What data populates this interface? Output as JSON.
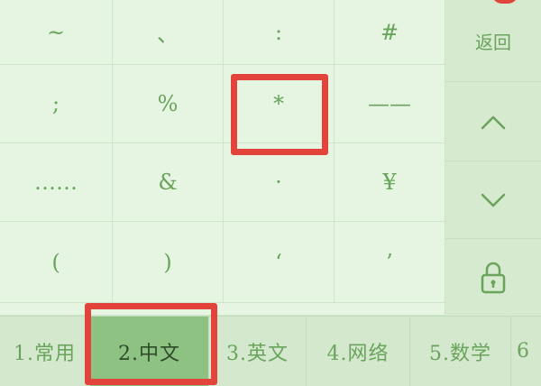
{
  "keypad": {
    "rows": [
      [
        "~",
        "、",
        ":",
        "#"
      ],
      [
        ";",
        "%",
        "*",
        "——"
      ],
      [
        "……",
        "&",
        "·",
        "¥"
      ],
      [
        "(",
        ")",
        "‘",
        "’"
      ]
    ]
  },
  "sidebar": {
    "back_label": "返回",
    "up_icon": "chevron-up-icon",
    "down_icon": "chevron-down-icon",
    "lock_icon": "lock-icon"
  },
  "tabs": [
    {
      "label": "1.常用"
    },
    {
      "label": "2.中文",
      "active": true
    },
    {
      "label": "3.英文"
    },
    {
      "label": "4.网络"
    },
    {
      "label": "5.数学"
    },
    {
      "label": "6"
    }
  ],
  "colors": {
    "accent": "#6aa35c",
    "active_tab": "#8dc283",
    "highlight": "#e2433b",
    "background": "#e3f2e0"
  }
}
